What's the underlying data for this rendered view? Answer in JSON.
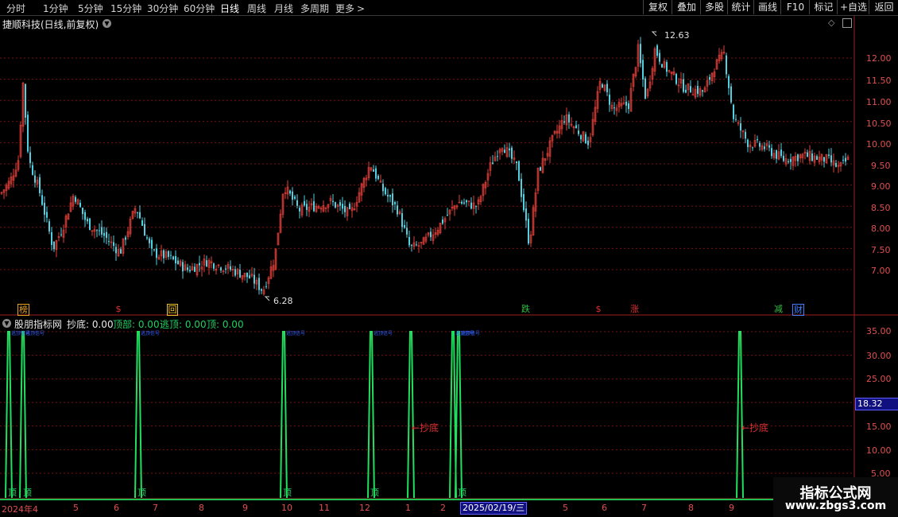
{
  "toolbar": {
    "tabs": [
      {
        "label": "分时"
      },
      {
        "label": "1分钟"
      },
      {
        "label": "5分钟"
      },
      {
        "label": "15分钟"
      },
      {
        "label": "30分钟"
      },
      {
        "label": "60分钟"
      },
      {
        "label": "日线"
      },
      {
        "label": "周线"
      },
      {
        "label": "月线"
      },
      {
        "label": "多周期"
      },
      {
        "label": "更多"
      }
    ],
    "buttons": [
      {
        "label": "复权"
      },
      {
        "label": "叠加"
      },
      {
        "label": "多股"
      },
      {
        "label": "统计"
      },
      {
        "label": "画线"
      },
      {
        "label": "F10"
      },
      {
        "label": "标记"
      },
      {
        "label": "+自选"
      },
      {
        "label": "返回"
      }
    ]
  },
  "main_chart": {
    "title": "捷顺科技(日线,前复权)",
    "price_axis": [
      "12.00",
      "11.50",
      "11.00",
      "10.50",
      "10.00",
      "9.50",
      "9.00",
      "8.50",
      "8.00",
      "7.50",
      "7.00"
    ],
    "high_annotation": "12.63",
    "low_annotation": "6.28",
    "events": [
      {
        "label": "榜",
        "color": "#e8a020"
      },
      {
        "label": "$",
        "color": "#e03030"
      },
      {
        "label": "回",
        "color": "#e8c030"
      },
      {
        "label": "跌",
        "color": "#30c040"
      },
      {
        "label": "$",
        "color": "#e03030"
      },
      {
        "label": "涨",
        "color": "#e03030"
      },
      {
        "label": "减",
        "color": "#30c040"
      },
      {
        "label": "财",
        "color": "#4080ff"
      }
    ]
  },
  "indicator": {
    "name": "股朋指标网",
    "chaodi": "抄底: 0.00",
    "dingbu": "顶部: 0.00",
    "taoding": "逃顶: 0.00",
    "ding": "顶: 0.00",
    "axis": [
      "35.00",
      "30.00",
      "25.00",
      "20.00",
      "15.00",
      "10.00",
      "5.00"
    ],
    "current_value": "18.32",
    "annotation_1": "←抄底",
    "annotation_2": "←抄底",
    "spike_label": "顶",
    "spike_top_text": "逃顶信号"
  },
  "date_axis": {
    "start": "2024年4",
    "labels": [
      "5",
      "6",
      "7",
      "8",
      "9",
      "10",
      "11",
      "12",
      "1",
      "2",
      "4",
      "5",
      "6",
      "7",
      "8",
      "9"
    ],
    "cursor_date": "2025/02/19/三"
  },
  "watermark": {
    "line1": "指标公式网",
    "line2": "www.zbgs3.com"
  },
  "colors": {
    "up": "#e0403a",
    "down": "#50d0e0",
    "signal": "#20e060",
    "grid": "#7a1010",
    "axis_text": "#e05050"
  }
}
